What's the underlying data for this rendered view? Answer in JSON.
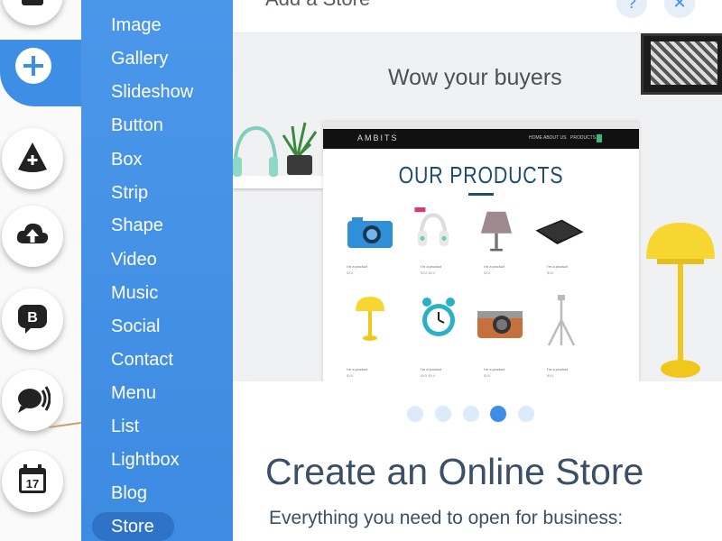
{
  "panel": {
    "title": "Add a Store",
    "hero_heading": "Wow your buyers",
    "help_icon": "question-icon",
    "close_icon": "close-icon",
    "main_title": "Create an Online Store",
    "subtitle": "Everything you need to open for business:",
    "carousel": {
      "count": 5,
      "active_index": 3
    }
  },
  "mockup": {
    "brand": "AMBITS",
    "nav_links": [
      "HOME",
      "ABOUT US",
      "PRODUCTS"
    ],
    "heading": "OUR PRODUCTS",
    "products": [
      {
        "name": "I'm a product",
        "price": "$XX",
        "icon": "camera"
      },
      {
        "name": "I'm a product",
        "price": "$XX $XX",
        "icon": "headphones"
      },
      {
        "name": "I'm a product",
        "price": "$XX",
        "icon": "lamp-shade"
      },
      {
        "name": "I'm a product",
        "price": "$XX",
        "icon": "tablet"
      },
      {
        "name": "I'm a product",
        "price": "$XX",
        "icon": "yellow-lamp"
      },
      {
        "name": "I'm a product",
        "price": "$XX $XX",
        "icon": "alarm-clock"
      },
      {
        "name": "I'm a product",
        "price": "$XX",
        "icon": "camera-brown"
      },
      {
        "name": "I'm a product",
        "price": "$XX",
        "icon": "tripod"
      }
    ]
  },
  "rail": {
    "buttons": [
      "text-box-icon",
      "add-icon",
      "app-market-icon",
      "upload-icon",
      "blog-icon",
      "chat-icon",
      "calendar-icon"
    ],
    "calendar_day": "17",
    "blog_letter": "B"
  },
  "menu": {
    "items": [
      "Image",
      "Gallery",
      "Slideshow",
      "Button",
      "Box",
      "Strip",
      "Shape",
      "Video",
      "Music",
      "Social",
      "Contact",
      "Menu",
      "List",
      "Lightbox",
      "Blog",
      "Store"
    ],
    "selected": "Store"
  },
  "colors": {
    "accent": "#3f8ee6",
    "menu_bg": "#4492e8",
    "title": "#3b4f66"
  }
}
